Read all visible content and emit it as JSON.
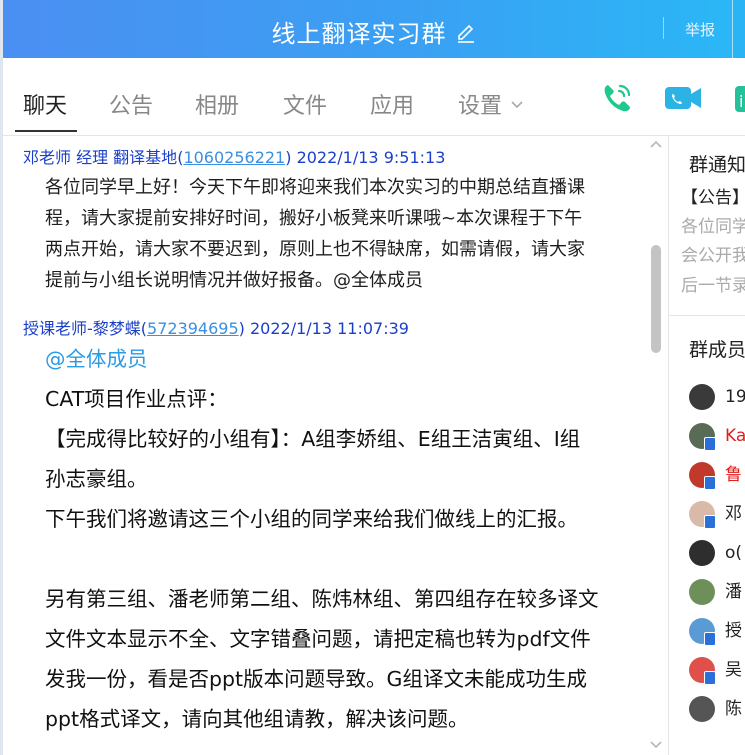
{
  "window": {
    "title": "线上翻译实习群",
    "report_label": "举报"
  },
  "tabs": [
    {
      "label": "聊天"
    },
    {
      "label": "公告"
    },
    {
      "label": "相册"
    },
    {
      "label": "文件"
    },
    {
      "label": "应用"
    },
    {
      "label": "设置"
    }
  ],
  "messages": [
    {
      "sender": "邓老师 经理  翻译基地",
      "qq": "1060256221",
      "time": "2022/1/13 9:51:13",
      "lines": [
        "各位同学早上好！今天下午即将迎来我们本次实习的中期总结直播课",
        "程，请大家提前安排好时间，搬好小板凳来听课哦~本次课程于下午",
        "两点开始，请大家不要迟到，原则上也不得缺席，如需请假，请大家",
        "提前与小组长说明情况并做好报备。@全体成员"
      ]
    },
    {
      "sender": "授课老师-黎梦蝶",
      "qq": "572394695",
      "time": "2022/1/13 11:07:39",
      "mention": "@全体成员",
      "lines": [
        "CAT项目作业点评：",
        "【完成得比较好的小组有】：A组李娇组、E组王洁寅组、I组",
        "孙志豪组。",
        "下午我们将邀请这三个小组的同学来给我们做线上的汇报。",
        "",
        "另有第三组、潘老师第二组、陈炜林组、第四组存在较多译文",
        "文件文本显示不全、文字错叠问题，请把定稿也转为pdf文件",
        "发我一份，看是否ppt版本问题导致。G组译文未能成功生成",
        "ppt格式译文，请向其他组请教，解决该问题。"
      ]
    }
  ],
  "notice": {
    "title": "群通知",
    "tag": "【公告】",
    "lines": [
      "各位同学",
      "会公开我",
      "后一节录"
    ]
  },
  "members": {
    "title": "群成员",
    "list": [
      {
        "name": "19",
        "color": "#222222",
        "avatar_color": "#3a3a3a",
        "badge": false
      },
      {
        "name": "Ka",
        "color": "#e02020",
        "avatar_color": "#5a6b55",
        "badge": true
      },
      {
        "name": "鲁",
        "color": "#e02020",
        "avatar_color": "#c0392b",
        "badge": true
      },
      {
        "name": "邓",
        "color": "#222222",
        "avatar_color": "#d9b9a8",
        "badge": true
      },
      {
        "name": "o(",
        "color": "#222222",
        "avatar_color": "#2e2e2e",
        "badge": false
      },
      {
        "name": "潘",
        "color": "#222222",
        "avatar_color": "#6e8f5a",
        "badge": false
      },
      {
        "name": "授",
        "color": "#222222",
        "avatar_color": "#5b9bd5",
        "badge": true
      },
      {
        "name": "吴",
        "color": "#222222",
        "avatar_color": "#e0504a",
        "badge": true
      },
      {
        "name": "陈",
        "color": "#222222",
        "avatar_color": "#555555",
        "badge": false
      }
    ]
  }
}
